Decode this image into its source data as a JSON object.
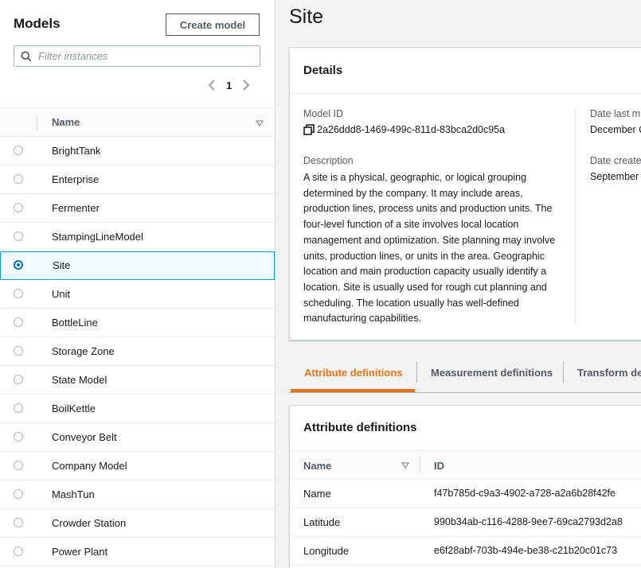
{
  "sidebar": {
    "title": "Models",
    "create_label": "Create model",
    "filter_placeholder": "Filter instances",
    "page": "1",
    "column_name": "Name",
    "items": [
      {
        "label": "BrightTank",
        "selected": false
      },
      {
        "label": "Enterprise",
        "selected": false
      },
      {
        "label": "Fermenter",
        "selected": false
      },
      {
        "label": "StampingLineModel",
        "selected": false
      },
      {
        "label": "Site",
        "selected": true
      },
      {
        "label": "Unit",
        "selected": false
      },
      {
        "label": "BottleLine",
        "selected": false
      },
      {
        "label": "Storage Zone",
        "selected": false
      },
      {
        "label": "State Model",
        "selected": false
      },
      {
        "label": "BoilKettle",
        "selected": false
      },
      {
        "label": "Conveyor Belt",
        "selected": false
      },
      {
        "label": "Company Model",
        "selected": false
      },
      {
        "label": "MashTun",
        "selected": false
      },
      {
        "label": "Crowder Station",
        "selected": false
      },
      {
        "label": "Power Plant",
        "selected": false
      }
    ]
  },
  "main": {
    "title": "Site",
    "details": {
      "heading": "Details",
      "model_id_label": "Model ID",
      "model_id": "2a26ddd8-1469-499c-811d-83bca2d0c95a",
      "description_label": "Description",
      "description": "A site is a physical, geographic, or logical grouping determined by the company. It may include areas, production lines, process units and production units. The four-level function of a site involves local location management and optimization. Site planning may involve units, production lines, or units in the area. Geographic location and main production capacity usually identify a location. Site is usually used for rough cut planning and scheduling. The location usually has well-defined manufacturing capabilities.",
      "date_modified_label": "Date last m",
      "date_modified": "December C",
      "date_created_label": "Date create",
      "date_created": "September"
    },
    "tabs": [
      {
        "label": "Attribute definitions",
        "active": true
      },
      {
        "label": "Measurement definitions",
        "active": false
      },
      {
        "label": "Transform de",
        "active": false
      }
    ],
    "attributes": {
      "heading": "Attribute definitions",
      "col_name": "Name",
      "col_id": "ID",
      "rows": [
        {
          "name": "Name",
          "id": "f47b785d-c9a3-4902-a728-a2a6b28f42fe"
        },
        {
          "name": "Latitude",
          "id": "990b34ab-c116-4288-9ee7-69ca2793d2a8"
        },
        {
          "name": "Longitude",
          "id": "e6f28abf-703b-494e-be38-c21b20c01c73"
        }
      ]
    }
  },
  "colors": {
    "accent_orange": "#ec7211",
    "selected_blue": "#0073bb",
    "selected_border": "#00a1c9"
  }
}
